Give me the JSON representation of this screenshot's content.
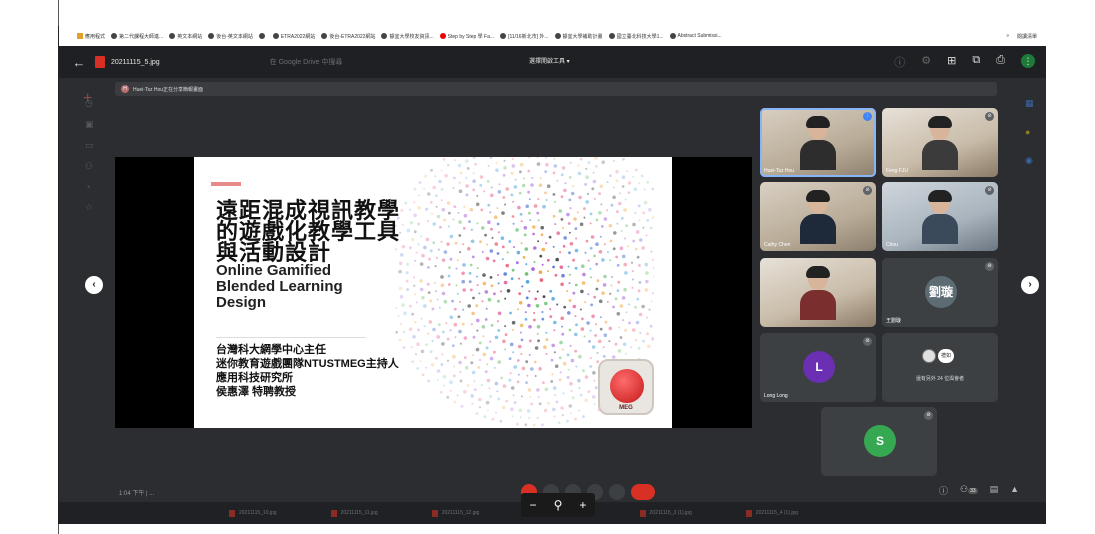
{
  "bookmarks": [
    {
      "icon": "apps-icon",
      "label": "應用程式"
    },
    {
      "icon": "bookmark-icon",
      "label": "第二代課程大師進..."
    },
    {
      "icon": "globe-icon",
      "label": "英文本網站"
    },
    {
      "icon": "globe-icon",
      "label": "後台-英文本網站"
    },
    {
      "icon": "globe-icon",
      "label": ""
    },
    {
      "icon": "globe-icon",
      "label": "ETRA2022網站"
    },
    {
      "icon": "globe-icon",
      "label": "後台-ETRA2022網站"
    },
    {
      "icon": "bookmark-icon",
      "label": "靜宜大學校友資訊..."
    },
    {
      "icon": "youtube-icon",
      "label": "Step by Step 學 Fa..."
    },
    {
      "icon": "bookmark-icon",
      "label": "[11/16新北市] 外..."
    },
    {
      "icon": "globe-icon",
      "label": "靜宜大學補助計畫"
    },
    {
      "icon": "globe-icon",
      "label": "國立臺北科技大學1..."
    },
    {
      "icon": "globe-icon",
      "label": "Abstract Submissi..."
    }
  ],
  "bookmarks_right": {
    "more": "»",
    "reading_list": "閱讀清單"
  },
  "viewer": {
    "back": "←",
    "filename": "20211115_5.jpg",
    "search_placeholder": "在 Google Drive 中搜尋",
    "open_with": "選擇開啟工具 ▾",
    "plus": "+"
  },
  "banner": {
    "initial": "H",
    "text": "Huei-Tsz Hou正在分享簡報畫面"
  },
  "slide": {
    "title": "遠距混成視訊教學\n的遊戲化教學工具\n與活動設計",
    "subtitle_en": "Online Gamified\nBlended Learning\nDesign",
    "info": "台灣科大網學中心主任\n迷你教育遊戲團隊NTUSTMEG主持人\n應用科技研究所\n侯惠澤 特聘教授",
    "logo_text": "MEG"
  },
  "participants": [
    {
      "name": "Huei-Tsz Hou",
      "kind": "video"
    },
    {
      "name": "Feng FJU",
      "kind": "video"
    },
    {
      "name": "Cathy Chen",
      "kind": "video"
    },
    {
      "name": "Chou",
      "kind": "video"
    },
    {
      "name": "",
      "kind": "video"
    },
    {
      "name": "王劉璇",
      "avatar": "劉璇",
      "kind": "avatar"
    },
    {
      "name": "Long Long",
      "avatar": "L",
      "kind": "avatar"
    },
    {
      "name": "還有另外 24 位與會者",
      "avatar": "禮如",
      "kind": "others"
    },
    {
      "name": "",
      "avatar": "S",
      "kind": "avatar"
    }
  ],
  "nav": {
    "prev": "‹",
    "next": "›"
  },
  "zoom": {
    "minus": "−",
    "search": "⚲",
    "plus": "+"
  },
  "bottom": {
    "time": "1:04 下午 | ...",
    "participants_count": "33"
  },
  "files": [
    "20211115_10.jpg",
    "20211115_11.jpg",
    "20211115_12.jpg",
    "20211115_2 (1).jpg",
    "20211115_3 (1).jpg",
    "20211115_4 (1).jpg"
  ],
  "colors": {
    "accent_red": "#d93025",
    "tile_bg": "#3c4043",
    "stage_bg": "#000000"
  }
}
